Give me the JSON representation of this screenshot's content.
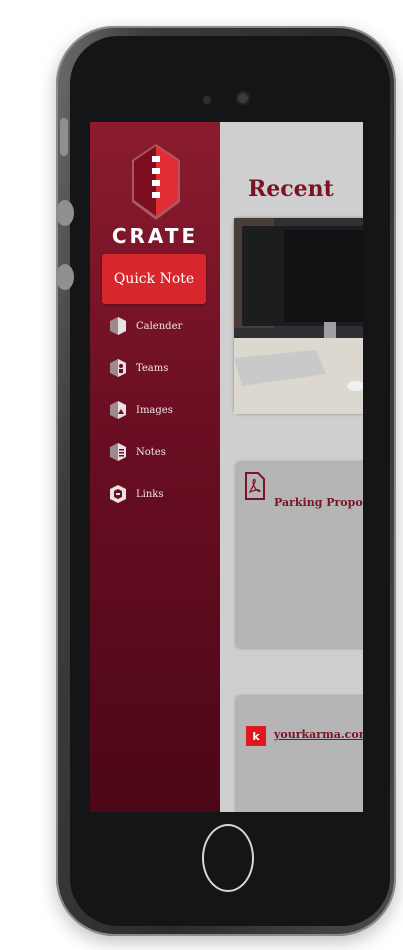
{
  "app": {
    "brand": "CRATE",
    "quick_note_label": "Quick Note",
    "recent_title": "Recent"
  },
  "sidebar": {
    "items": [
      {
        "label": "Calender",
        "icon": "calendar-icon"
      },
      {
        "label": "Teams",
        "icon": "teams-icon"
      },
      {
        "label": "Images",
        "icon": "images-icon"
      },
      {
        "label": "Notes",
        "icon": "notes-icon"
      },
      {
        "label": "Links",
        "icon": "links-icon"
      }
    ]
  },
  "cards": [
    {
      "type": "image",
      "icon": "photo-icon"
    },
    {
      "type": "pdf",
      "title": "Parking Proposal",
      "icon": "pdf-icon"
    },
    {
      "type": "link",
      "title": "yourkarma.com",
      "icon": "kr-logo-icon",
      "icon_text": "k"
    }
  ],
  "colors": {
    "sidebar_top": "#8a1c2e",
    "sidebar_bottom": "#4c0717",
    "accent_red": "#d8262d",
    "title_maroon": "#7a1326",
    "content_bg": "#cfcfcf"
  }
}
